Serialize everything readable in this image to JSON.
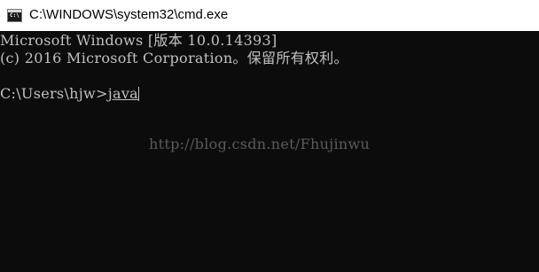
{
  "window": {
    "title": "C:\\WINDOWS\\system32\\cmd.exe",
    "icon": "cmd-app-icon",
    "icon_label": "C:\\"
  },
  "console": {
    "background": "#0c0c0c",
    "text_color": "#c0c0c0",
    "lines": {
      "banner": "Microsoft Windows [版本 10.0.14393]",
      "copyright": "(c) 2016 Microsoft Corporation。保留所有权利。",
      "prompt": "C:\\Users\\hjw>",
      "command": "java"
    }
  },
  "watermark": "http://blog.csdn.net/Fhujinwu"
}
